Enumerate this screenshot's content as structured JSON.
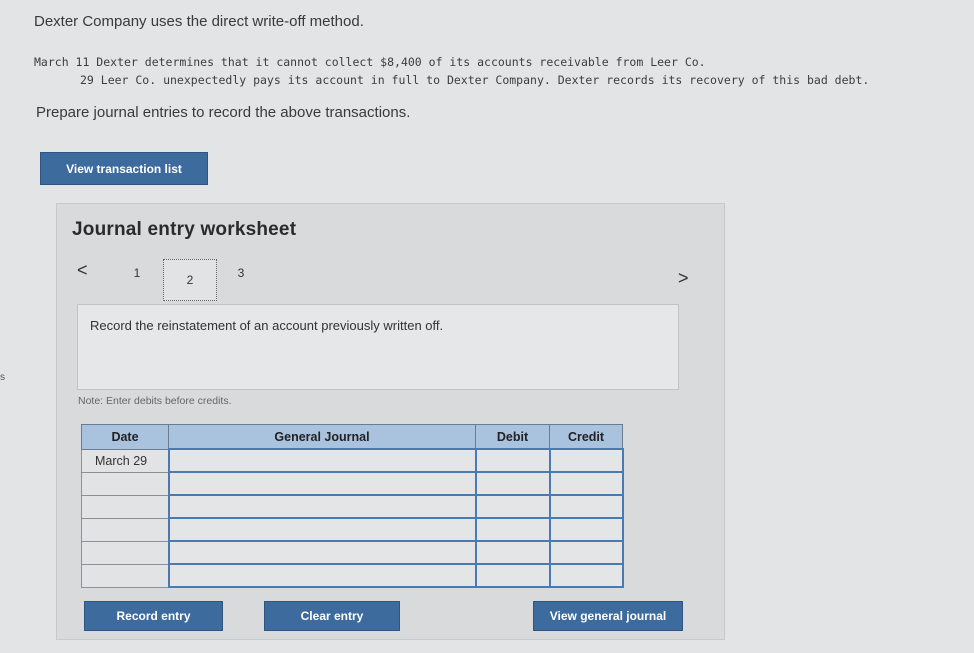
{
  "intro": "Dexter Company uses the direct write-off method.",
  "transactions": [
    "March 11 Dexter determines that it cannot collect $8,400 of its accounts receivable from Leer Co.",
    "29 Leer Co. unexpectedly pays its account in full to Dexter Company. Dexter records its recovery of this bad debt."
  ],
  "prompt": "Prepare journal entries to record the above transactions.",
  "buttons": {
    "view_transaction_list": "View transaction list",
    "record_entry": "Record entry",
    "clear_entry": "Clear entry",
    "view_general_journal": "View general journal"
  },
  "worksheet": {
    "title": "Journal entry worksheet",
    "prev": "<",
    "next": ">",
    "steps": [
      "1",
      "2",
      "3"
    ],
    "active_step": "2",
    "description": "Record the reinstatement of an account previously written off.",
    "note": "Note: Enter debits before credits."
  },
  "journal": {
    "headers": [
      "Date",
      "General Journal",
      "Debit",
      "Credit"
    ],
    "rows": [
      {
        "date": "March 29",
        "account": "",
        "debit": "",
        "credit": ""
      },
      {
        "date": "",
        "account": "",
        "debit": "",
        "credit": ""
      },
      {
        "date": "",
        "account": "",
        "debit": "",
        "credit": ""
      },
      {
        "date": "",
        "account": "",
        "debit": "",
        "credit": ""
      },
      {
        "date": "",
        "account": "",
        "debit": "",
        "credit": ""
      },
      {
        "date": "",
        "account": "",
        "debit": "",
        "credit": ""
      }
    ]
  },
  "colors": {
    "button": "#3d6b9e",
    "header": "#a9c2de",
    "background": "#e3e4e5"
  }
}
